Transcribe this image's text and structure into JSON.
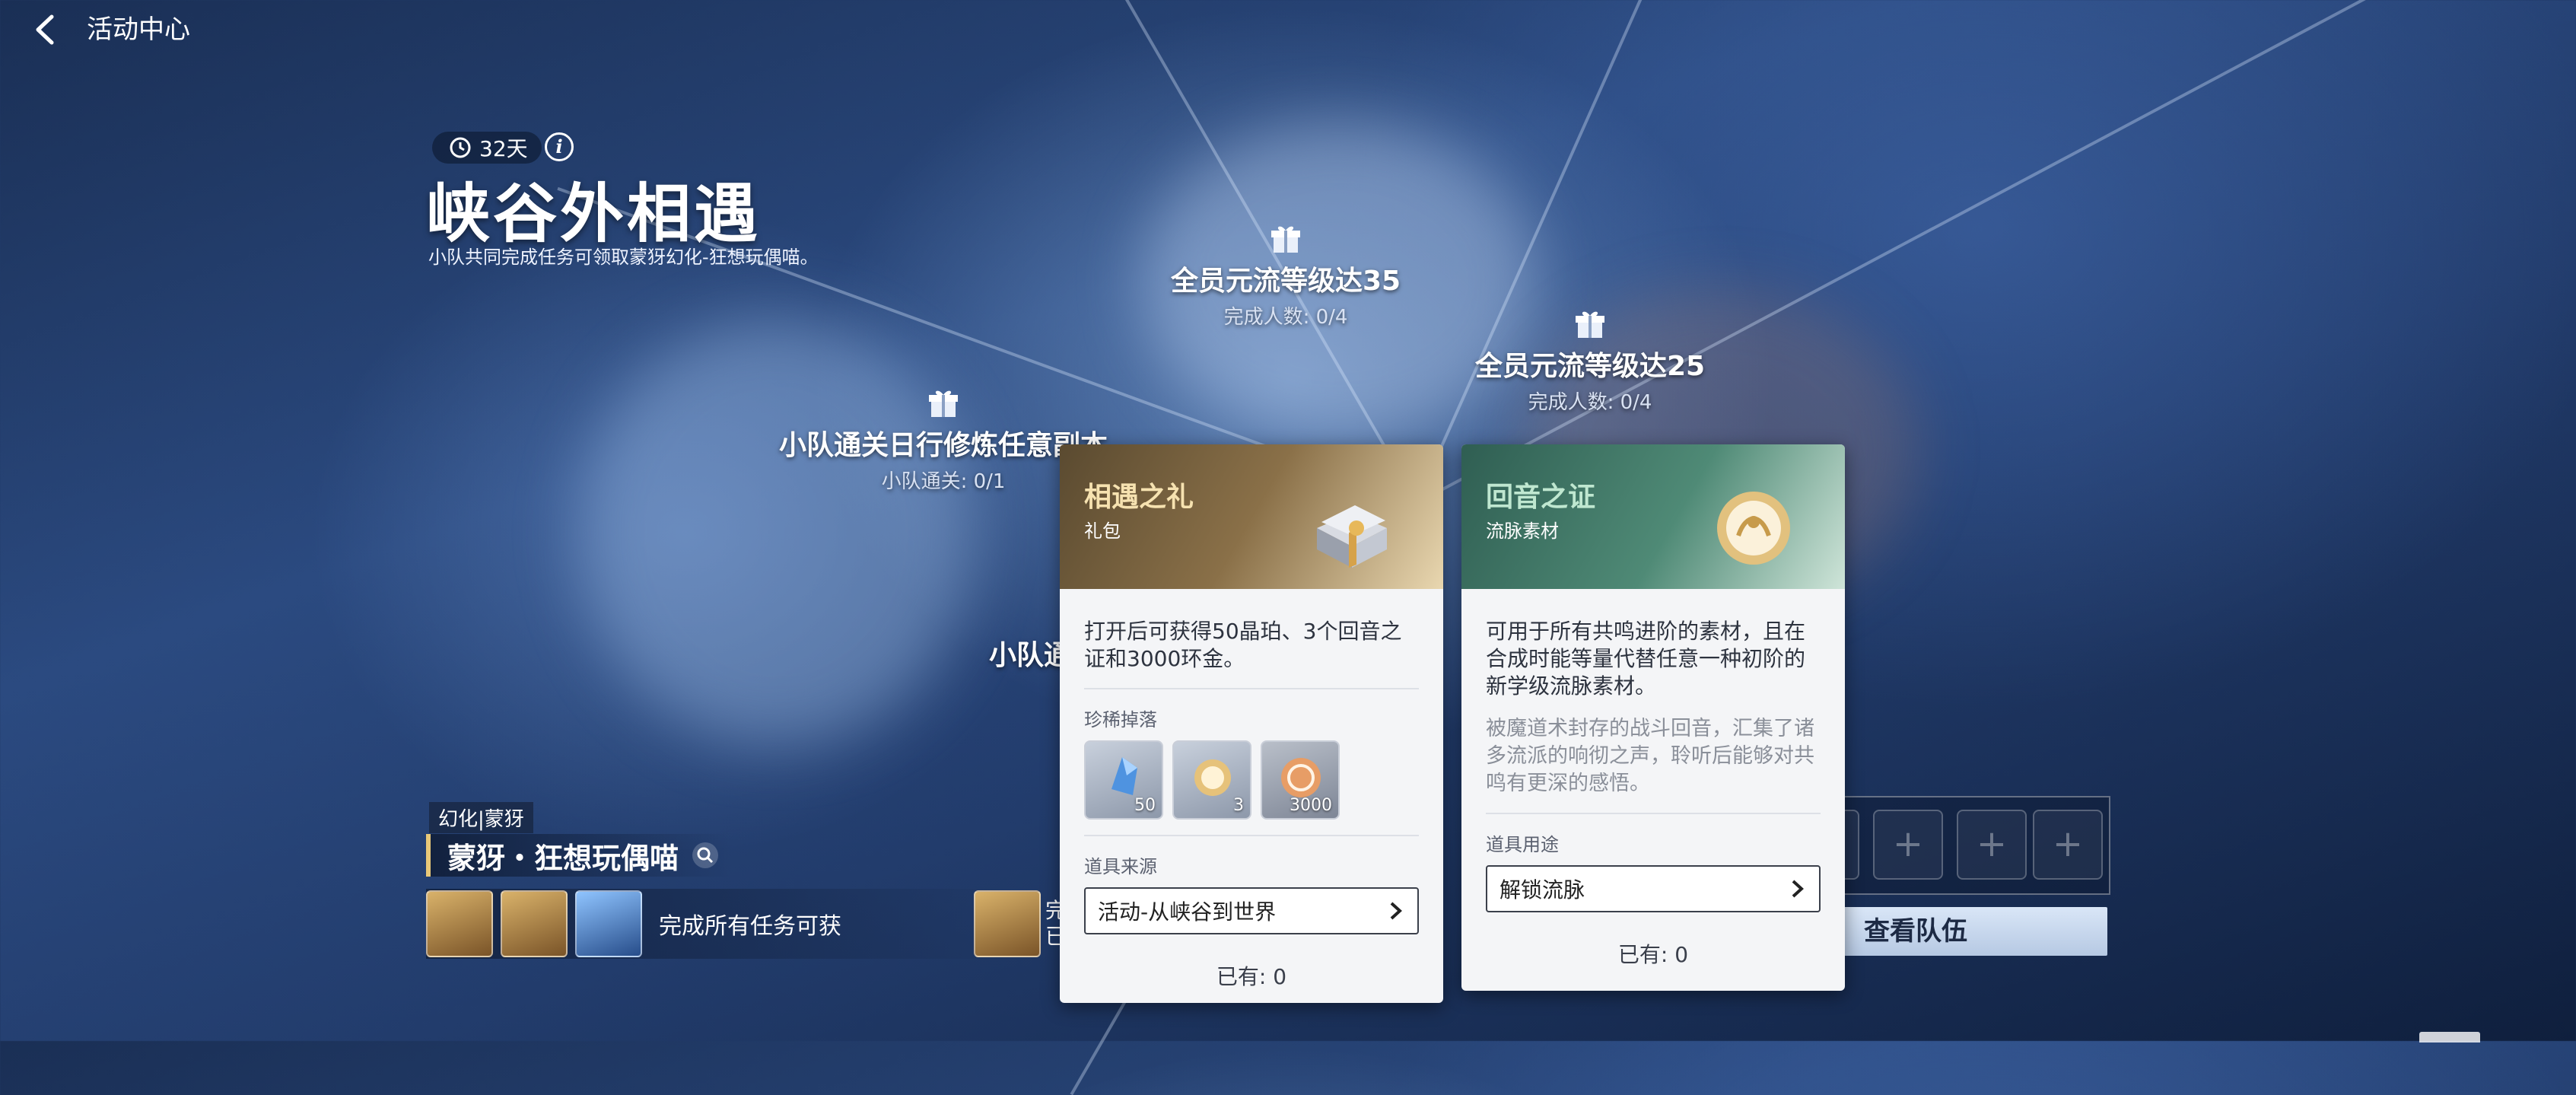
{
  "header": {
    "title": "活动中心"
  },
  "event": {
    "timer": "32天",
    "title": "峡谷外相遇",
    "subtitle": "小队共同完成任务可领取蒙犽幻化-狂想玩偶喵。"
  },
  "tasks": [
    {
      "title": "全员元流等级达35",
      "progress": "完成人数: 0/4"
    },
    {
      "title": "全员元流等级达25",
      "progress": "完成人数: 0/4"
    },
    {
      "title": "小队通关日行修炼任意副本",
      "progress": "小队通关: 0/1"
    },
    {
      "title": "小队通",
      "progress": ""
    }
  ],
  "reward": {
    "tag": "幻化|蒙犽",
    "name": "蒙犽・狂想玩偶喵",
    "text": "完成所有任务可获",
    "side_text_line1": "完",
    "side_text_line2": "已"
  },
  "team": {
    "view_team": "查看队伍"
  },
  "cards": {
    "gift": {
      "name": "相遇之礼",
      "type": "礼包",
      "desc": "打开后可获得50晶珀、3个回音之证和3000环金。",
      "drops_label": "珍稀掉落",
      "drops": [
        {
          "icon": "crystal-icon",
          "qty": "50"
        },
        {
          "icon": "echo-proof-icon",
          "qty": "3"
        },
        {
          "icon": "coin-icon",
          "qty": "3000"
        }
      ],
      "source_label": "道具来源",
      "source": "活动-从峡谷到世界",
      "owned": "已有:  0"
    },
    "echo": {
      "name": "回音之证",
      "type": "流脉素材",
      "desc": "可用于所有共鸣进阶的素材，且在合成时能等量代替任意一种初阶的新学级流脉素材。",
      "lore": "被魔道术封存的战斗回音，汇集了诸多流派的响彻之声，聆听后能够对共鸣有更深的感悟。",
      "use_label": "道具用途",
      "use": "解锁流脉",
      "owned": "已有:  0"
    }
  },
  "colors": {
    "gift_header": "#6b5838",
    "echo_header": "#3e7a68",
    "accent_gold": "#e8c878"
  }
}
